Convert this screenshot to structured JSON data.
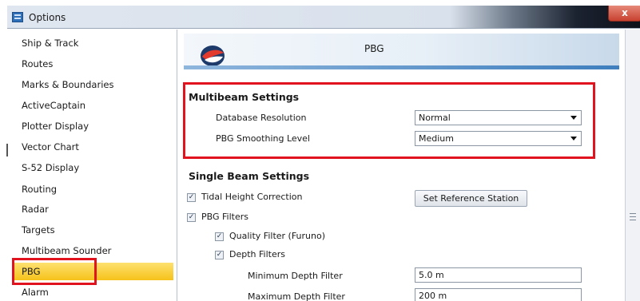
{
  "window": {
    "title": "Options",
    "close_label": "x"
  },
  "sidebar": {
    "items": [
      {
        "label": "Ship & Track"
      },
      {
        "label": "Routes"
      },
      {
        "label": "Marks & Boundaries"
      },
      {
        "label": "ActiveCaptain"
      },
      {
        "label": "Plotter Display"
      },
      {
        "label": "Vector Chart"
      },
      {
        "label": "S-52 Display"
      },
      {
        "label": "Routing"
      },
      {
        "label": "Radar"
      },
      {
        "label": "Targets"
      },
      {
        "label": "Multibeam Sounder"
      },
      {
        "label": "PBG",
        "selected": true
      },
      {
        "label": "Alarm"
      }
    ]
  },
  "banner": {
    "title": "PBG"
  },
  "multibeam": {
    "title": "Multibeam Settings",
    "database_resolution": {
      "label": "Database Resolution",
      "value": "Normal"
    },
    "smoothing_level": {
      "label": "PBG Smoothing Level",
      "value": "Medium"
    }
  },
  "single_beam": {
    "title": "Single Beam Settings",
    "tidal_height": {
      "label": "Tidal Height Correction",
      "checked": true
    },
    "set_reference_button": "Set Reference Station",
    "pbg_filters": {
      "label": "PBG Filters",
      "checked": true
    },
    "quality_filter": {
      "label": "Quality Filter (Furuno)",
      "checked": true
    },
    "depth_filters": {
      "label": "Depth Filters",
      "checked": true
    },
    "min_depth": {
      "label": "Minimum Depth Filter",
      "value": "5.0 m"
    },
    "max_depth": {
      "label": "Maximum Depth Filter",
      "value": "200 m"
    }
  },
  "colors": {
    "highlight": "#e0131f",
    "selected_item": "#f6c21a",
    "accent": "#3f7fbe"
  }
}
